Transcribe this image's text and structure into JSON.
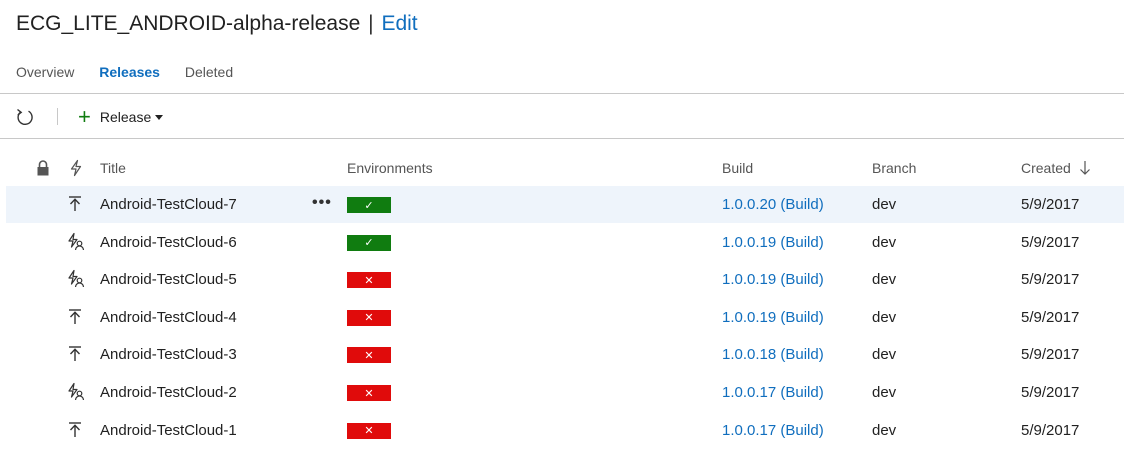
{
  "header": {
    "title": "ECG_LITE_ANDROID-alpha-release",
    "separator": "|",
    "edit_label": "Edit"
  },
  "tabs": [
    {
      "label": "Overview",
      "active": false
    },
    {
      "label": "Releases",
      "active": true
    },
    {
      "label": "Deleted",
      "active": false
    }
  ],
  "toolbar": {
    "refresh_icon": "refresh-icon",
    "release_label": "Release"
  },
  "columns": {
    "title": "Title",
    "environments": "Environments",
    "build": "Build",
    "branch": "Branch",
    "created": "Created"
  },
  "colors": {
    "accent": "#106ebe",
    "success": "#107c10",
    "failure": "#e00b0b",
    "selected_row": "#eef4fb"
  },
  "releases": [
    {
      "trigger_icon": "manual-deploy-icon",
      "title": "Android-TestCloud-7",
      "env_status": "succeeded",
      "env_glyph": "✓",
      "build": "1.0.0.20 (Build)",
      "branch": "dev",
      "created": "5/9/2017",
      "selected": true
    },
    {
      "trigger_icon": "auto-trigger-icon",
      "title": "Android-TestCloud-6",
      "env_status": "succeeded",
      "env_glyph": "✓",
      "build": "1.0.0.19 (Build)",
      "branch": "dev",
      "created": "5/9/2017"
    },
    {
      "trigger_icon": "auto-trigger-icon",
      "title": "Android-TestCloud-5",
      "env_status": "failed",
      "env_glyph": "✕",
      "build": "1.0.0.19 (Build)",
      "branch": "dev",
      "created": "5/9/2017"
    },
    {
      "trigger_icon": "manual-deploy-icon",
      "title": "Android-TestCloud-4",
      "env_status": "failed",
      "env_glyph": "✕",
      "build": "1.0.0.19 (Build)",
      "branch": "dev",
      "created": "5/9/2017"
    },
    {
      "trigger_icon": "manual-deploy-icon",
      "title": "Android-TestCloud-3",
      "env_status": "failed",
      "env_glyph": "✕",
      "build": "1.0.0.18 (Build)",
      "branch": "dev",
      "created": "5/9/2017"
    },
    {
      "trigger_icon": "auto-trigger-icon",
      "title": "Android-TestCloud-2",
      "env_status": "failed",
      "env_glyph": "✕",
      "build": "1.0.0.17 (Build)",
      "branch": "dev",
      "created": "5/9/2017"
    },
    {
      "trigger_icon": "manual-deploy-icon",
      "title": "Android-TestCloud-1",
      "env_status": "failed",
      "env_glyph": "✕",
      "build": "1.0.0.17 (Build)",
      "branch": "dev",
      "created": "5/9/2017"
    }
  ]
}
